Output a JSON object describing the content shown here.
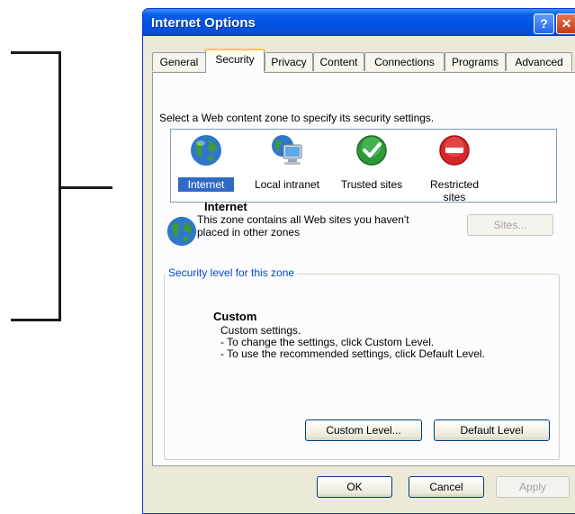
{
  "window": {
    "title": "Internet Options",
    "help_glyph": "?",
    "close_glyph": "✕"
  },
  "tabs": [
    {
      "label": "General"
    },
    {
      "label": "Security",
      "active": true
    },
    {
      "label": "Privacy"
    },
    {
      "label": "Content"
    },
    {
      "label": "Connections"
    },
    {
      "label": "Programs"
    },
    {
      "label": "Advanced"
    }
  ],
  "security": {
    "instruction": "Select a Web content zone to specify its security settings.",
    "zones": [
      {
        "label": "Internet",
        "icon": "globe-icon",
        "selected": true
      },
      {
        "label": "Local intranet",
        "icon": "computer-globe-icon"
      },
      {
        "label": "Trusted sites",
        "icon": "checkmark-icon"
      },
      {
        "label": "Restricted\nsites",
        "icon": "restricted-icon"
      }
    ],
    "selected_zone_title": "Internet",
    "selected_zone_description": "This zone contains all Web sites you haven't placed in other zones",
    "sites_button": "Sites...",
    "level_group_label": "Security level for this zone",
    "level_title": "Custom",
    "level_description": "Custom settings.\n- To change the settings, click Custom Level.\n- To use the recommended settings, click Default Level.",
    "custom_level_button": "Custom Level...",
    "default_level_button": "Default Level"
  },
  "footer": {
    "ok": "OK",
    "cancel": "Cancel",
    "apply": "Apply"
  },
  "colors": {
    "titlebar": "#0054e3",
    "dialog_bg": "#ece9d8",
    "selection": "#316ac5",
    "group_label": "#0046d5"
  }
}
